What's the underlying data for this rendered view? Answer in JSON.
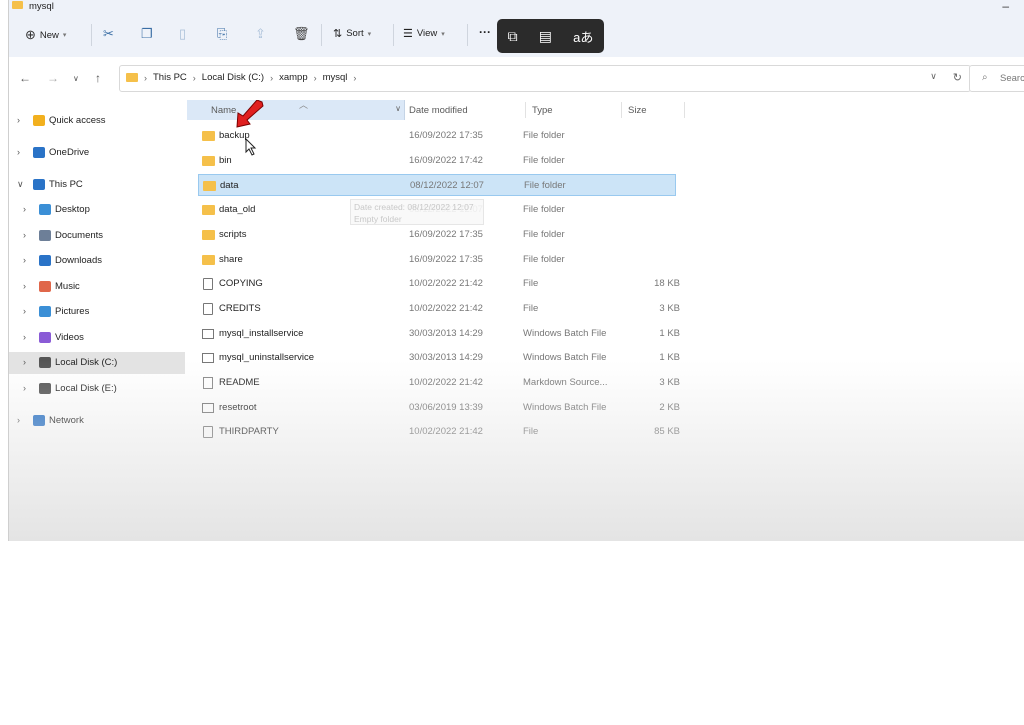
{
  "window": {
    "title": "mysql",
    "minimize": "–"
  },
  "toolbar": {
    "new_label": "New",
    "sort_label": "Sort",
    "view_label": "View",
    "more_label": "···",
    "cut_icon": "scissors-icon",
    "copy_icon": "copy-icon",
    "paste_icon": "paste-icon",
    "rename_icon": "rename-icon",
    "share_icon": "share-icon",
    "delete_icon": "trash-icon"
  },
  "popup": {
    "translate_glyph": "aあ"
  },
  "address": {
    "crumbs": [
      "This PC",
      "Local Disk (C:)",
      "xampp",
      "mysql"
    ]
  },
  "search": {
    "placeholder": "Searc"
  },
  "sidebar": {
    "items": [
      {
        "label": "Quick access",
        "icon": "star-icon",
        "color": "#f2b01e"
      },
      {
        "label": "OneDrive",
        "icon": "cloud-icon",
        "color": "#2a73c7"
      },
      {
        "label": "This PC",
        "icon": "monitor-icon",
        "color": "#2a73c7"
      },
      {
        "label": "Desktop",
        "icon": "desktop-icon",
        "color": "#3b8fd6"
      },
      {
        "label": "Documents",
        "icon": "document-icon",
        "color": "#6d7f98"
      },
      {
        "label": "Downloads",
        "icon": "download-icon",
        "color": "#2a73c7"
      },
      {
        "label": "Music",
        "icon": "music-icon",
        "color": "#e0674a"
      },
      {
        "label": "Pictures",
        "icon": "pictures-icon",
        "color": "#3b8fd6"
      },
      {
        "label": "Videos",
        "icon": "video-icon",
        "color": "#8a5bd6"
      },
      {
        "label": "Local Disk (C:)",
        "icon": "drive-icon",
        "color": "#555555"
      },
      {
        "label": "Local Disk (E:)",
        "icon": "drive-icon",
        "color": "#555555"
      },
      {
        "label": "Network",
        "icon": "network-icon",
        "color": "#2a73c7"
      }
    ]
  },
  "columns": {
    "name": "Name",
    "date": "Date modified",
    "type": "Type",
    "size": "Size"
  },
  "files": [
    {
      "name": "backup",
      "date": "16/09/2022 17:35",
      "type": "File folder",
      "size": "",
      "kind": "folder"
    },
    {
      "name": "bin",
      "date": "16/09/2022 17:42",
      "type": "File folder",
      "size": "",
      "kind": "folder"
    },
    {
      "name": "data",
      "date": "08/12/2022 12:07",
      "type": "File folder",
      "size": "",
      "kind": "folder"
    },
    {
      "name": "data_old",
      "date": "08/12/2022 12:07",
      "type": "File folder",
      "size": "",
      "kind": "folder"
    },
    {
      "name": "scripts",
      "date": "16/09/2022 17:35",
      "type": "File folder",
      "size": "",
      "kind": "folder"
    },
    {
      "name": "share",
      "date": "16/09/2022 17:35",
      "type": "File folder",
      "size": "",
      "kind": "folder"
    },
    {
      "name": "COPYING",
      "date": "10/02/2022 21:42",
      "type": "File",
      "size": "18 KB",
      "kind": "doc"
    },
    {
      "name": "CREDITS",
      "date": "10/02/2022 21:42",
      "type": "File",
      "size": "3 KB",
      "kind": "doc"
    },
    {
      "name": "mysql_installservice",
      "date": "30/03/2013 14:29",
      "type": "Windows Batch File",
      "size": "1 KB",
      "kind": "bat"
    },
    {
      "name": "mysql_uninstallservice",
      "date": "30/03/2013 14:29",
      "type": "Windows Batch File",
      "size": "1 KB",
      "kind": "bat"
    },
    {
      "name": "README",
      "date": "10/02/2022 21:42",
      "type": "Markdown Source...",
      "size": "3 KB",
      "kind": "md"
    },
    {
      "name": "resetroot",
      "date": "03/06/2019 13:39",
      "type": "Windows Batch File",
      "size": "2 KB",
      "kind": "bat"
    },
    {
      "name": "THIRDPARTY",
      "date": "10/02/2022 21:42",
      "type": "File",
      "size": "85 KB",
      "kind": "doc"
    }
  ],
  "tooltip": {
    "line1": "Date created: 08/12/2022 12:07",
    "line2": "Empty folder"
  },
  "colors": {
    "accent": "#3a6ea5",
    "selection": "#cce4f7",
    "folder": "#f5c04a",
    "annotation_arrow": "#e02020"
  }
}
